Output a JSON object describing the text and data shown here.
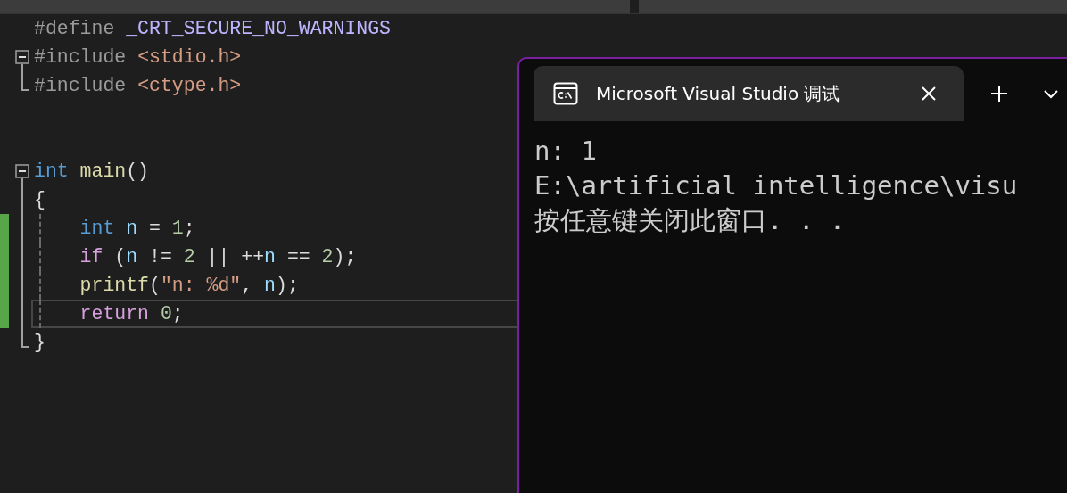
{
  "editor": {
    "lines": [
      {
        "kind": "plain",
        "changed": false,
        "current": false,
        "guide": false,
        "tokens": [
          {
            "text": "#define ",
            "kind": "preproc"
          },
          {
            "text": "_CRT_SECURE_NO_WARNINGS",
            "kind": "macro"
          }
        ]
      },
      {
        "kind": "start",
        "changed": false,
        "current": false,
        "guide": false,
        "tokens": [
          {
            "text": "#include ",
            "kind": "preproc"
          },
          {
            "text": "<stdio.h>",
            "kind": "string"
          }
        ]
      },
      {
        "kind": "end",
        "changed": false,
        "current": false,
        "guide": false,
        "tokens": [
          {
            "text": "#include ",
            "kind": "preproc"
          },
          {
            "text": "<ctype.h>",
            "kind": "string"
          }
        ]
      },
      {
        "kind": "plain",
        "changed": false,
        "current": false,
        "guide": false
      },
      {
        "kind": "plain",
        "changed": false,
        "current": false,
        "guide": false
      },
      {
        "kind": "start",
        "changed": false,
        "current": false,
        "guide": false,
        "tokens": [
          {
            "text": "int ",
            "kind": "keyword"
          },
          {
            "text": "main",
            "kind": "function"
          },
          {
            "text": "()",
            "kind": "plain"
          }
        ]
      },
      {
        "kind": "inner",
        "changed": false,
        "current": false,
        "guide": false,
        "tokens": [
          {
            "text": "{",
            "kind": "plain"
          }
        ]
      },
      {
        "kind": "inner",
        "changed": true,
        "current": false,
        "guide": true,
        "tokens": [
          {
            "text": "    int ",
            "kind": "keyword"
          },
          {
            "text": "n",
            "kind": "variable"
          },
          {
            "text": " = ",
            "kind": "plain"
          },
          {
            "text": "1",
            "kind": "number"
          },
          {
            "text": ";",
            "kind": "plain"
          }
        ]
      },
      {
        "kind": "inner",
        "changed": true,
        "current": false,
        "guide": true,
        "tokens": [
          {
            "text": "    if",
            "kind": "control"
          },
          {
            "text": " (",
            "kind": "plain"
          },
          {
            "text": "n",
            "kind": "variable"
          },
          {
            "text": " != ",
            "kind": "plain"
          },
          {
            "text": "2",
            "kind": "number"
          },
          {
            "text": " || ++",
            "kind": "plain"
          },
          {
            "text": "n",
            "kind": "variable"
          },
          {
            "text": " == ",
            "kind": "plain"
          },
          {
            "text": "2",
            "kind": "number"
          },
          {
            "text": ");",
            "kind": "plain"
          }
        ]
      },
      {
        "kind": "inner",
        "changed": true,
        "current": false,
        "guide": true,
        "tokens": [
          {
            "text": "    printf",
            "kind": "function"
          },
          {
            "text": "(",
            "kind": "plain"
          },
          {
            "text": "\"n: %d\"",
            "kind": "string"
          },
          {
            "text": ", ",
            "kind": "plain"
          },
          {
            "text": "n",
            "kind": "variable"
          },
          {
            "text": ");",
            "kind": "plain"
          }
        ]
      },
      {
        "kind": "inner",
        "changed": true,
        "current": true,
        "guide": true,
        "tokens": [
          {
            "text": "    return ",
            "kind": "control"
          },
          {
            "text": "0",
            "kind": "number"
          },
          {
            "text": ";",
            "kind": "plain"
          }
        ]
      },
      {
        "kind": "end",
        "changed": false,
        "current": false,
        "guide": false,
        "tokens": [
          {
            "text": "}",
            "kind": "plain"
          }
        ]
      }
    ]
  },
  "terminal": {
    "tab": {
      "title": "Microsoft Visual Studio 调试",
      "selected": true
    },
    "output": [
      "n: 1",
      "E:\\artificial intelligence\\visu",
      "按任意键关闭此窗口. . ."
    ]
  }
}
